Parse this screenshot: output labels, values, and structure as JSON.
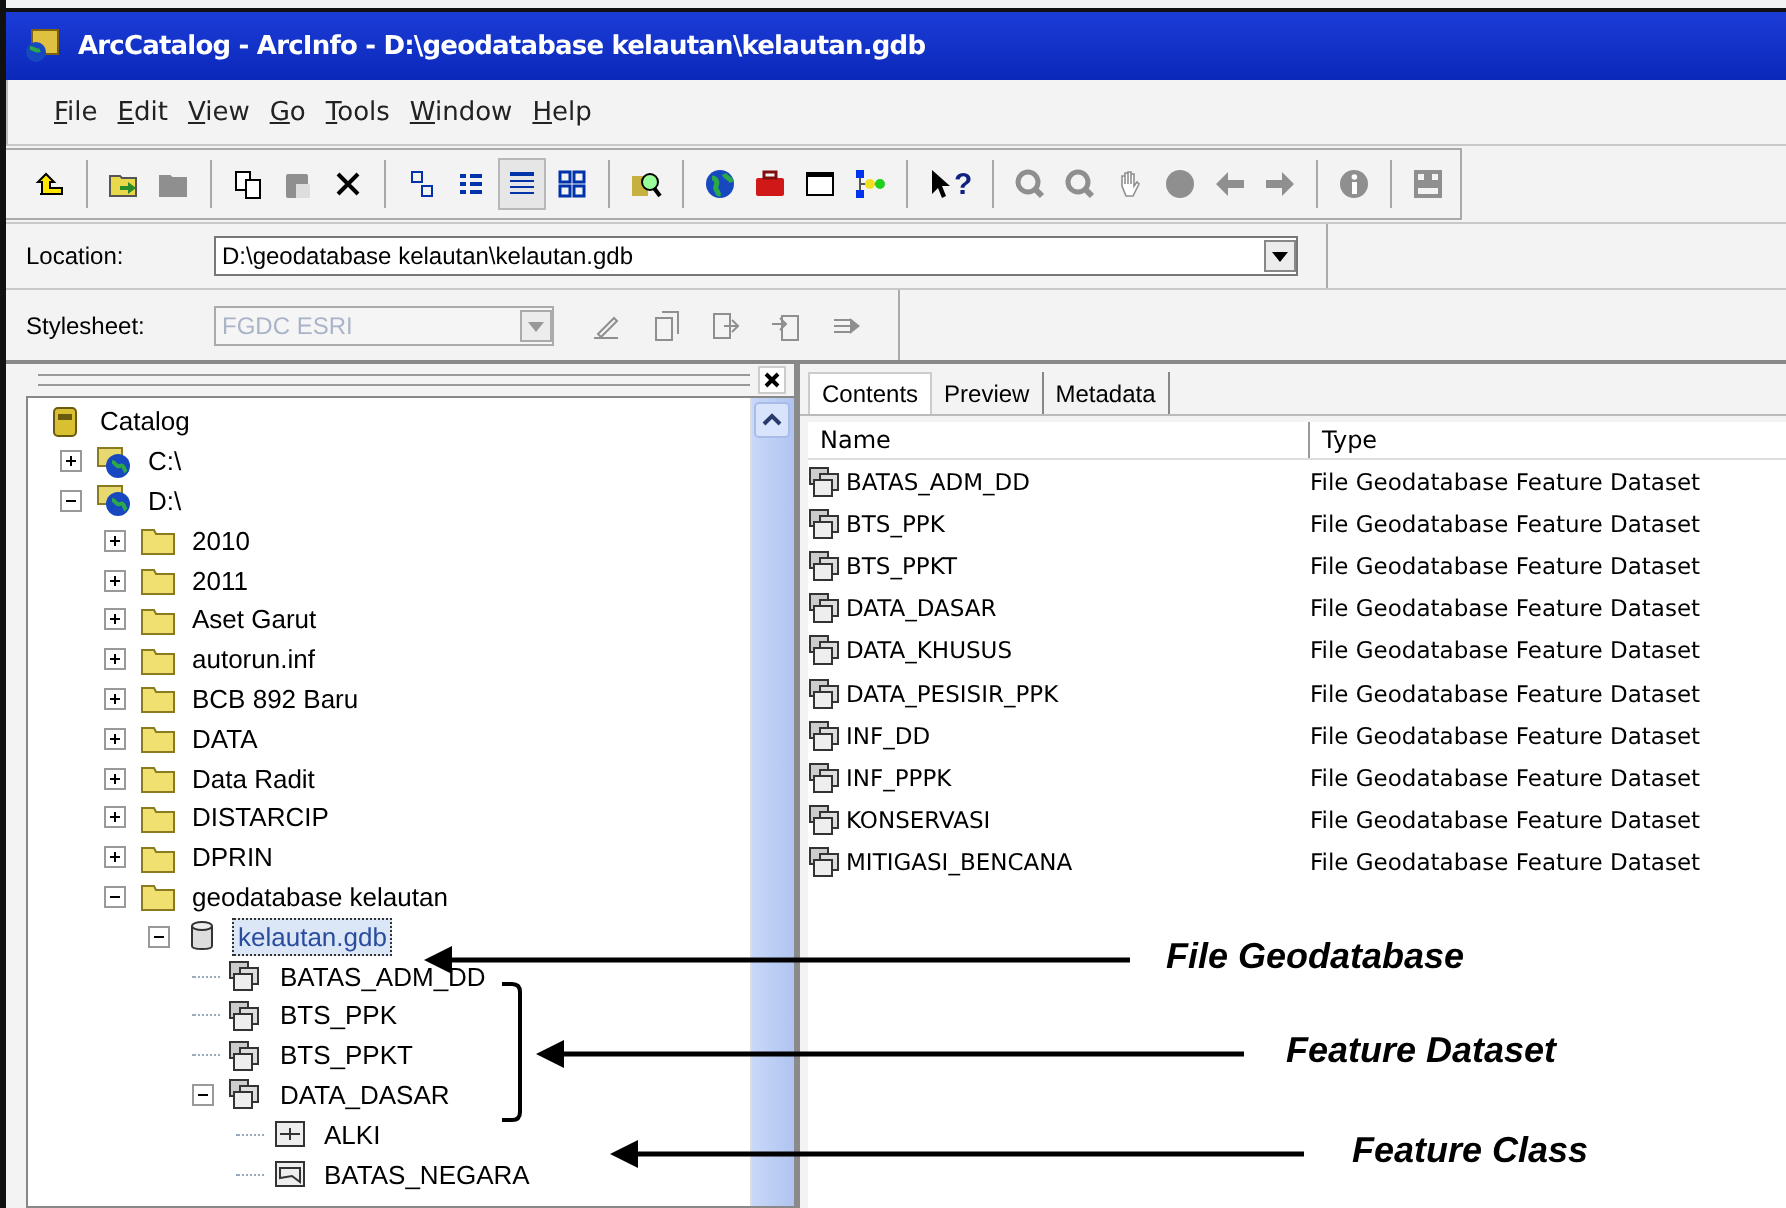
{
  "window": {
    "title": "ArcCatalog - ArcInfo - D:\\geodatabase kelautan\\kelautan.gdb"
  },
  "menu": [
    "File",
    "Edit",
    "View",
    "Go",
    "Tools",
    "Window",
    "Help"
  ],
  "toolbar": [
    [
      {
        "kind": "up",
        "disabled": false,
        "selected": false
      }
    ],
    [
      {
        "kind": "connect",
        "disabled": false,
        "selected": false
      },
      {
        "kind": "disconnect",
        "disabled": true,
        "selected": false
      }
    ],
    [
      {
        "kind": "copy",
        "disabled": false,
        "selected": false
      },
      {
        "kind": "paste",
        "disabled": true,
        "selected": false
      },
      {
        "kind": "delete",
        "disabled": false,
        "selected": false
      }
    ],
    [
      {
        "kind": "large-icons",
        "disabled": false,
        "selected": false
      },
      {
        "kind": "list",
        "disabled": false,
        "selected": false
      },
      {
        "kind": "details",
        "disabled": false,
        "selected": true
      },
      {
        "kind": "thumbnails",
        "disabled": false,
        "selected": false
      }
    ],
    [
      {
        "kind": "search",
        "disabled": false,
        "selected": false
      }
    ],
    [
      {
        "kind": "globe",
        "disabled": false,
        "selected": false
      },
      {
        "kind": "toolbox",
        "disabled": false,
        "selected": false
      },
      {
        "kind": "command",
        "disabled": false,
        "selected": false
      },
      {
        "kind": "model",
        "disabled": false,
        "selected": false
      }
    ],
    [
      {
        "kind": "whats-this",
        "glyph": "?",
        "disabled": false,
        "selected": false
      }
    ],
    [
      {
        "kind": "zoom-in",
        "disabled": true,
        "selected": false
      },
      {
        "kind": "zoom-out",
        "disabled": true,
        "selected": false
      },
      {
        "kind": "pan",
        "disabled": true,
        "selected": false
      },
      {
        "kind": "full-extent",
        "disabled": true,
        "selected": false
      },
      {
        "kind": "back",
        "disabled": true,
        "selected": false
      },
      {
        "kind": "forward",
        "disabled": true,
        "selected": false
      }
    ],
    [
      {
        "kind": "identify",
        "disabled": true,
        "selected": false
      }
    ],
    [
      {
        "kind": "create-thumbnail",
        "disabled": true,
        "selected": false
      }
    ]
  ],
  "location": {
    "label": "Location:",
    "value": "D:\\geodatabase kelautan\\kelautan.gdb"
  },
  "stylesheet": {
    "label": "Stylesheet:",
    "value": "FGDC ESRI",
    "disabled": true,
    "tools": [
      {
        "kind": "edit",
        "disabled": true
      },
      {
        "kind": "properties",
        "disabled": true
      },
      {
        "kind": "import",
        "disabled": true
      },
      {
        "kind": "export",
        "disabled": true
      },
      {
        "kind": "update",
        "disabled": true
      }
    ]
  },
  "catalog_tree": [
    {
      "label": "Catalog",
      "kind": "catalog",
      "selected": false,
      "children": [
        {
          "label": "C:\\",
          "kind": "drive",
          "expanded": false,
          "selected": false
        },
        {
          "label": "D:\\",
          "kind": "drive",
          "expanded": true,
          "selected": false,
          "children": [
            {
              "label": "2010",
              "kind": "folder",
              "expanded": false,
              "selected": false
            },
            {
              "label": "2011",
              "kind": "folder",
              "expanded": false,
              "selected": false
            },
            {
              "label": "Aset Garut",
              "kind": "folder",
              "expanded": false,
              "selected": false
            },
            {
              "label": "autorun.inf",
              "kind": "folder",
              "expanded": false,
              "selected": false
            },
            {
              "label": "BCB 892 Baru",
              "kind": "folder",
              "expanded": false,
              "selected": false
            },
            {
              "label": "DATA",
              "kind": "folder",
              "expanded": false,
              "selected": false
            },
            {
              "label": "Data Radit",
              "kind": "folder",
              "expanded": false,
              "selected": false
            },
            {
              "label": "DISTARCIP",
              "kind": "folder",
              "expanded": false,
              "selected": false
            },
            {
              "label": "DPRIN",
              "kind": "folder",
              "expanded": false,
              "selected": false
            },
            {
              "label": "geodatabase kelautan",
              "kind": "folder",
              "expanded": true,
              "selected": false,
              "children": [
                {
                  "label": "kelautan.gdb",
                  "kind": "geodatabase",
                  "expanded": true,
                  "selected": true,
                  "children": [
                    {
                      "label": "BATAS_ADM_DD",
                      "kind": "feature_dataset",
                      "selected": false
                    },
                    {
                      "label": "BTS_PPK",
                      "kind": "feature_dataset",
                      "selected": false
                    },
                    {
                      "label": "BTS_PPKT",
                      "kind": "feature_dataset",
                      "selected": false
                    },
                    {
                      "label": "DATA_DASAR",
                      "kind": "feature_dataset",
                      "expanded": true,
                      "selected": false,
                      "children": [
                        {
                          "label": "ALKI",
                          "kind": "line_feature_class",
                          "selected": false
                        },
                        {
                          "label": "BATAS_NEGARA",
                          "kind": "polygon_feature_class",
                          "selected": false
                        }
                      ]
                    }
                  ]
                }
              ]
            }
          ]
        }
      ]
    }
  ],
  "tabs": [
    {
      "label": "Contents",
      "selected": true
    },
    {
      "label": "Preview",
      "selected": false
    },
    {
      "label": "Metadata",
      "selected": false
    }
  ],
  "table": {
    "columns": [
      "Name",
      "Type"
    ],
    "rows": [
      [
        "BATAS_ADM_DD",
        "File Geodatabase Feature Dataset"
      ],
      [
        "BTS_PPK",
        "File Geodatabase Feature Dataset"
      ],
      [
        "BTS_PPKT",
        "File Geodatabase Feature Dataset"
      ],
      [
        "DATA_DASAR",
        "File Geodatabase Feature Dataset"
      ],
      [
        "DATA_KHUSUS",
        "File Geodatabase Feature Dataset"
      ],
      [
        "DATA_PESISIR_PPK",
        "File Geodatabase Feature Dataset"
      ],
      [
        "INF_DD",
        "File Geodatabase Feature Dataset"
      ],
      [
        "INF_PPPK",
        "File Geodatabase Feature Dataset"
      ],
      [
        "KONSERVASI",
        "File Geodatabase Feature Dataset"
      ],
      [
        "MITIGASI_BENCANA",
        "File Geodatabase Feature Dataset"
      ]
    ]
  },
  "annotations": [
    {
      "text": "File Geodatabase"
    },
    {
      "text": "Feature Dataset"
    },
    {
      "text": "Feature Class"
    }
  ]
}
